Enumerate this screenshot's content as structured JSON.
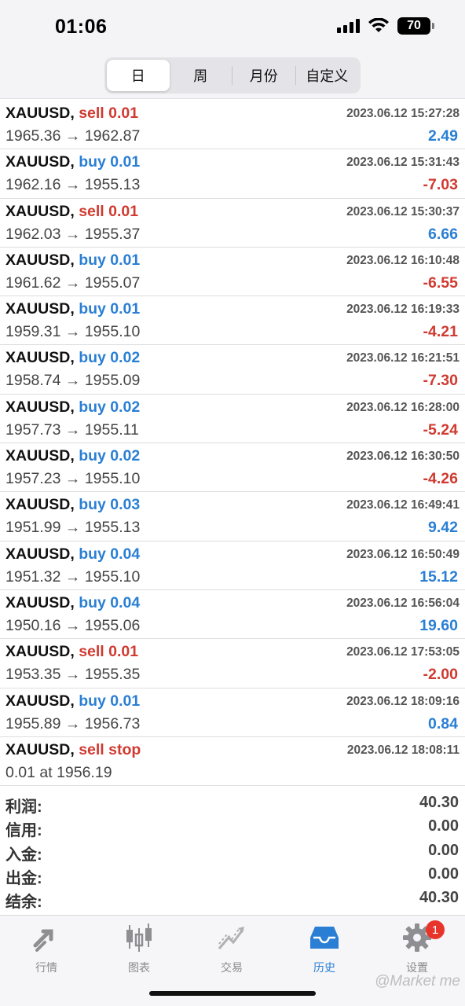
{
  "status_bar": {
    "time": "01:06",
    "battery": "70"
  },
  "period_tabs": [
    {
      "label": "日",
      "active": true
    },
    {
      "label": "周",
      "active": false
    },
    {
      "label": "月份",
      "active": false
    },
    {
      "label": "自定义",
      "active": false
    }
  ],
  "deals": [
    {
      "symbol": "XAUUSD,",
      "side": "sell 0.01",
      "side_type": "sell",
      "time": "2023.06.12 15:27:28",
      "prices": "1965.36 → 1962.87",
      "profit": "2.49",
      "profit_sign": "pos"
    },
    {
      "symbol": "XAUUSD,",
      "side": "buy 0.01",
      "side_type": "buy",
      "time": "2023.06.12 15:31:43",
      "prices": "1962.16 → 1955.13",
      "profit": "-7.03",
      "profit_sign": "neg"
    },
    {
      "symbol": "XAUUSD,",
      "side": "sell 0.01",
      "side_type": "sell",
      "time": "2023.06.12 15:30:37",
      "prices": "1962.03 → 1955.37",
      "profit": "6.66",
      "profit_sign": "pos"
    },
    {
      "symbol": "XAUUSD,",
      "side": "buy 0.01",
      "side_type": "buy",
      "time": "2023.06.12 16:10:48",
      "prices": "1961.62 → 1955.07",
      "profit": "-6.55",
      "profit_sign": "neg"
    },
    {
      "symbol": "XAUUSD,",
      "side": "buy 0.01",
      "side_type": "buy",
      "time": "2023.06.12 16:19:33",
      "prices": "1959.31 → 1955.10",
      "profit": "-4.21",
      "profit_sign": "neg"
    },
    {
      "symbol": "XAUUSD,",
      "side": "buy 0.02",
      "side_type": "buy",
      "time": "2023.06.12 16:21:51",
      "prices": "1958.74 → 1955.09",
      "profit": "-7.30",
      "profit_sign": "neg"
    },
    {
      "symbol": "XAUUSD,",
      "side": "buy 0.02",
      "side_type": "buy",
      "time": "2023.06.12 16:28:00",
      "prices": "1957.73 → 1955.11",
      "profit": "-5.24",
      "profit_sign": "neg"
    },
    {
      "symbol": "XAUUSD,",
      "side": "buy 0.02",
      "side_type": "buy",
      "time": "2023.06.12 16:30:50",
      "prices": "1957.23 → 1955.10",
      "profit": "-4.26",
      "profit_sign": "neg"
    },
    {
      "symbol": "XAUUSD,",
      "side": "buy 0.03",
      "side_type": "buy",
      "time": "2023.06.12 16:49:41",
      "prices": "1951.99 → 1955.13",
      "profit": "9.42",
      "profit_sign": "pos"
    },
    {
      "symbol": "XAUUSD,",
      "side": "buy 0.04",
      "side_type": "buy",
      "time": "2023.06.12 16:50:49",
      "prices": "1951.32 → 1955.10",
      "profit": "15.12",
      "profit_sign": "pos"
    },
    {
      "symbol": "XAUUSD,",
      "side": "buy 0.04",
      "side_type": "buy",
      "time": "2023.06.12 16:56:04",
      "prices": "1950.16 → 1955.06",
      "profit": "19.60",
      "profit_sign": "pos"
    },
    {
      "symbol": "XAUUSD,",
      "side": "sell 0.01",
      "side_type": "sell",
      "time": "2023.06.12 17:53:05",
      "prices": "1953.35 → 1955.35",
      "profit": "-2.00",
      "profit_sign": "neg"
    },
    {
      "symbol": "XAUUSD,",
      "side": "buy 0.01",
      "side_type": "buy",
      "time": "2023.06.12 18:09:16",
      "prices": "1955.89 → 1956.73",
      "profit": "0.84",
      "profit_sign": "pos"
    },
    {
      "symbol": "XAUUSD,",
      "side": "sell stop",
      "side_type": "sell",
      "time": "2023.06.12 18:08:11",
      "prices": "0.01 at 1956.19",
      "profit": "",
      "profit_sign": "pos"
    }
  ],
  "summary": [
    {
      "label": "利润:",
      "value": "40.30"
    },
    {
      "label": "信用:",
      "value": "0.00"
    },
    {
      "label": "入金:",
      "value": "0.00"
    },
    {
      "label": "出金:",
      "value": "0.00"
    },
    {
      "label": "结余:",
      "value": "40.30"
    }
  ],
  "tabbar": {
    "quotes": "行情",
    "charts": "图表",
    "trade": "交易",
    "history": "历史",
    "settings": "设置",
    "settings_badge": "1"
  },
  "watermark": "@Market me",
  "colors": {
    "sell": "#d03a30",
    "buy": "#2a7fd4",
    "active_tab": "#2a7fd4",
    "badge": "#e8352b"
  }
}
